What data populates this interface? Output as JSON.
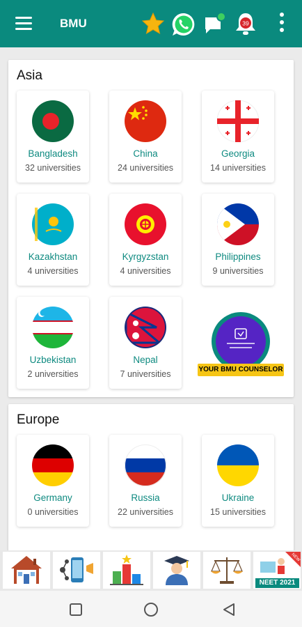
{
  "app": {
    "title": "BMU",
    "notification_count": "39"
  },
  "colors": {
    "primary": "#0a8a7e",
    "country_name": "#0e8a80"
  },
  "sections": [
    {
      "title": "Asia",
      "countries": [
        {
          "name": "Bangladesh",
          "count": "32 universities",
          "icon": "bangladesh-flag-icon"
        },
        {
          "name": "China",
          "count": "24 universities",
          "icon": "china-flag-icon"
        },
        {
          "name": "Georgia",
          "count": "14 universities",
          "icon": "georgia-flag-icon"
        },
        {
          "name": "Kazakhstan",
          "count": "4 universities",
          "icon": "kazakhstan-flag-icon"
        },
        {
          "name": "Kyrgyzstan",
          "count": "4 universities",
          "icon": "kyrgyzstan-flag-icon"
        },
        {
          "name": "Philippines",
          "count": "9 universities",
          "icon": "philippines-flag-icon"
        },
        {
          "name": "Uzbekistan",
          "count": "2 universities",
          "icon": "uzbekistan-flag-icon"
        },
        {
          "name": "Nepal",
          "count": "7 universities",
          "icon": "nepal-flag-icon"
        }
      ]
    },
    {
      "title": "Europe",
      "countries": [
        {
          "name": "Germany",
          "count": "0 universities",
          "icon": "germany-flag-icon"
        },
        {
          "name": "Russia",
          "count": "22 universities",
          "icon": "russia-flag-icon"
        },
        {
          "name": "Ukraine",
          "count": "15 universities",
          "icon": "ukraine-flag-icon"
        }
      ]
    }
  ],
  "counselor": {
    "label": "YOUR BMU COUNSELOR"
  },
  "bottom_nav": {
    "items": [
      {
        "icon": "home-icon"
      },
      {
        "icon": "share-icon"
      },
      {
        "icon": "ranking-icon"
      },
      {
        "icon": "graduate-icon"
      },
      {
        "icon": "scales-icon"
      },
      {
        "icon": "neet-icon",
        "label": "NEET 2021",
        "badge": "NEW"
      }
    ]
  }
}
